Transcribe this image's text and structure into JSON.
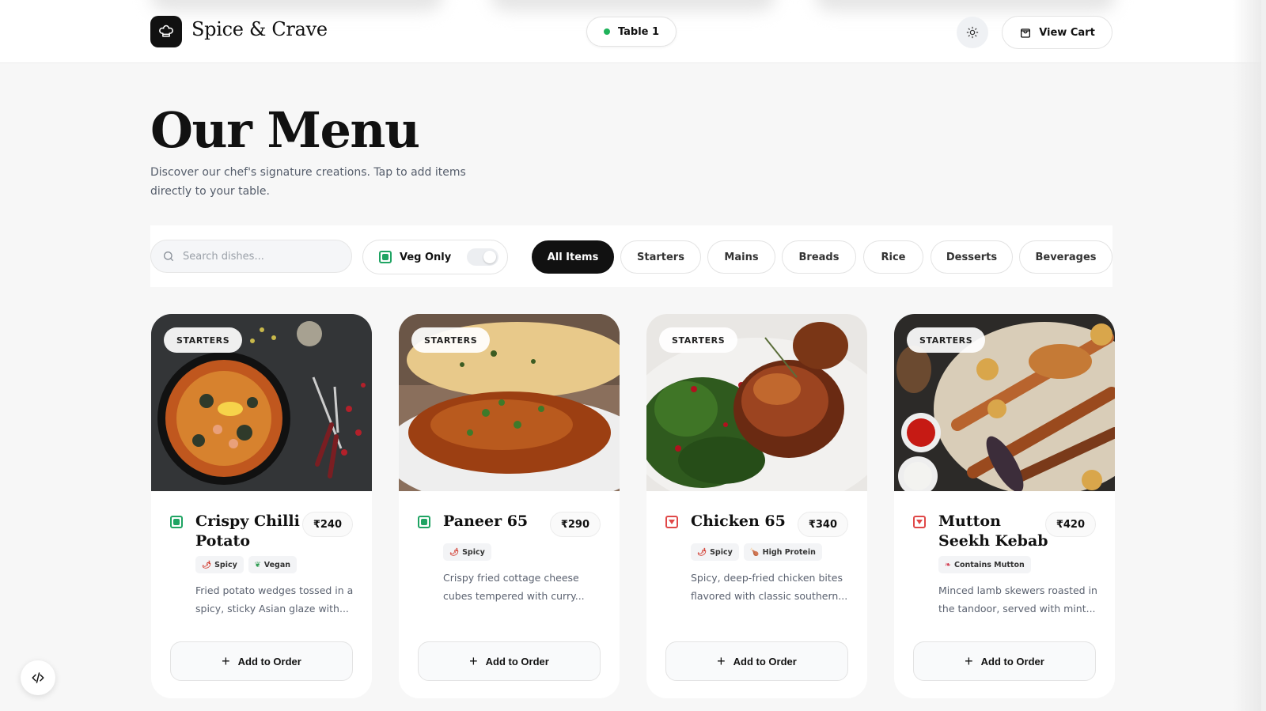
{
  "header": {
    "brand": "Spice & Crave",
    "table_label": "Table 1",
    "cart_label": "View Cart"
  },
  "hero": {
    "title": "Our Menu",
    "subtitle": "Discover our chef's signature creations. Tap to add items directly to your table."
  },
  "filters": {
    "search_placeholder": "Search dishes...",
    "veg_only_label": "Veg Only",
    "veg_only_enabled": false,
    "categories": [
      "All Items",
      "Starters",
      "Mains",
      "Breads",
      "Rice",
      "Desserts",
      "Beverages"
    ],
    "active_category": "All Items"
  },
  "dishes": [
    {
      "badge": "STARTERS",
      "name": "Crispy Chilli Potato",
      "price": "₹240",
      "veg": true,
      "tags": [
        "Spicy",
        "Vegan"
      ],
      "description": "Fried potato wedges tossed in a spicy, sticky Asian glaze with...",
      "add_label": "Add to Order"
    },
    {
      "badge": "STARTERS",
      "name": "Paneer 65",
      "price": "₹290",
      "veg": true,
      "tags": [
        "Spicy"
      ],
      "description": "Crispy fried cottage cheese cubes tempered with curry...",
      "add_label": "Add to Order"
    },
    {
      "badge": "STARTERS",
      "name": "Chicken 65",
      "price": "₹340",
      "veg": false,
      "tags": [
        "Spicy",
        "High Protein"
      ],
      "description": "Spicy, deep-fried chicken bites flavored with classic southern...",
      "add_label": "Add to Order"
    },
    {
      "badge": "STARTERS",
      "name": "Mutton Seekh Kebab",
      "price": "₹420",
      "veg": false,
      "tags": [
        "Contains Mutton"
      ],
      "description": "Minced lamb skewers roasted in the tandoor, served with mint...",
      "add_label": "Add to Order"
    }
  ],
  "colors": {
    "accent": "#111111",
    "veg": "#1fa463",
    "non_veg": "#e04848",
    "status_online": "#1fb25a"
  },
  "icons": [
    "chef-hat-icon",
    "sun-icon",
    "shopping-bag-icon",
    "search-icon",
    "plus-icon",
    "code-icon",
    "chili-icon",
    "leaf-icon",
    "drumstick-icon",
    "meat-icon"
  ]
}
